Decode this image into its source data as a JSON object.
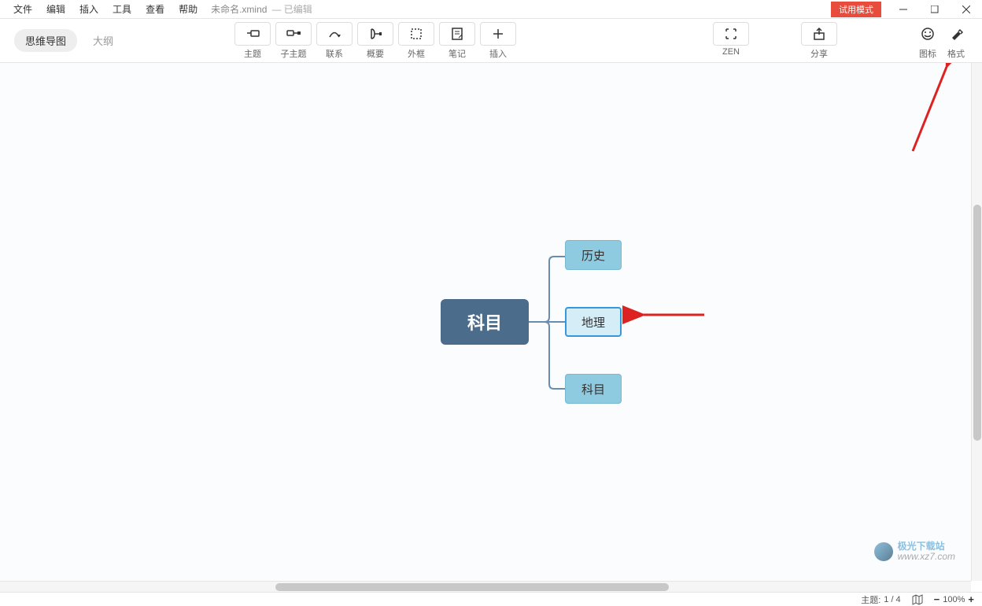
{
  "menu": [
    "文件",
    "编辑",
    "插入",
    "工具",
    "查看",
    "帮助"
  ],
  "doc": {
    "name": "未命名.xmind",
    "status": "— 已编辑"
  },
  "trial": "试用模式",
  "tabs": {
    "mindmap": "思维导图",
    "outline": "大纲"
  },
  "tools": {
    "topic": "主题",
    "subtopic": "子主题",
    "relation": "联系",
    "summary": "概要",
    "boundary": "外框",
    "note": "笔记",
    "insert": "插入",
    "zen": "ZEN",
    "share": "分享",
    "icons": "图标",
    "format": "格式"
  },
  "mindmap": {
    "central": "科目",
    "children": [
      "历史",
      "地理",
      "科目"
    ],
    "selected_index": 1
  },
  "status": {
    "topic_label": "主题:",
    "topic_count": "1 / 4",
    "zoom": "100%"
  },
  "watermark": {
    "line1": "极光下载站",
    "line2": "www.xz7.com"
  }
}
